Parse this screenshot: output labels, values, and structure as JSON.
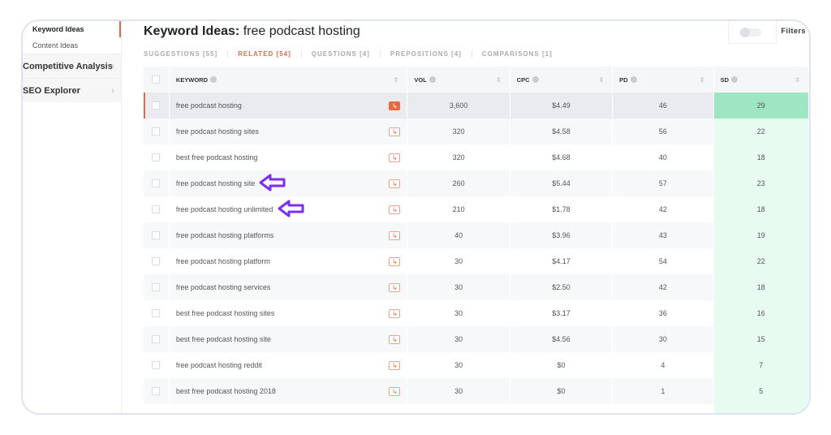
{
  "sidebar": {
    "sub_items": [
      "Keyword Ideas",
      "Content Ideas"
    ],
    "items": [
      "Competitive Analysis",
      "SEO Explorer"
    ]
  },
  "header": {
    "title_bold": "Keyword Ideas:",
    "title_query": "free podcast hosting",
    "filters_label": "Filters"
  },
  "tabs": [
    "SUGGESTIONS [55]",
    "RELATED [54]",
    "QUESTIONS [4]",
    "PREPOSITIONS [4]",
    "COMPARISONS [1]"
  ],
  "columns": [
    "KEYWORD",
    "VOL",
    "CPC",
    "PD",
    "SD"
  ],
  "rows": [
    {
      "keyword": "free podcast hosting",
      "vol": "3,600",
      "cpc": "$4.49",
      "pd": "46",
      "sd": "29"
    },
    {
      "keyword": "free podcast hosting sites",
      "vol": "320",
      "cpc": "$4.58",
      "pd": "56",
      "sd": "22"
    },
    {
      "keyword": "best free podcast hosting",
      "vol": "320",
      "cpc": "$4.68",
      "pd": "40",
      "sd": "18"
    },
    {
      "keyword": "free podcast hosting site",
      "vol": "260",
      "cpc": "$5.44",
      "pd": "57",
      "sd": "23"
    },
    {
      "keyword": "free podcast hosting unlimited",
      "vol": "210",
      "cpc": "$1.78",
      "pd": "42",
      "sd": "18"
    },
    {
      "keyword": "free podcast hosting platforms",
      "vol": "40",
      "cpc": "$3.96",
      "pd": "43",
      "sd": "19"
    },
    {
      "keyword": "free podcast hosting platform",
      "vol": "30",
      "cpc": "$4.17",
      "pd": "54",
      "sd": "22"
    },
    {
      "keyword": "free podcast hosting services",
      "vol": "30",
      "cpc": "$2.50",
      "pd": "42",
      "sd": "18"
    },
    {
      "keyword": "best free podcast hosting sites",
      "vol": "30",
      "cpc": "$3.17",
      "pd": "36",
      "sd": "16"
    },
    {
      "keyword": "best free podcast hosting site",
      "vol": "30",
      "cpc": "$4.56",
      "pd": "30",
      "sd": "15"
    },
    {
      "keyword": "free podcast hosting reddit",
      "vol": "30",
      "cpc": "$0",
      "pd": "4",
      "sd": "7"
    },
    {
      "keyword": "best free podcast hosting 2018",
      "vol": "30",
      "cpc": "$0",
      "pd": "1",
      "sd": "5"
    }
  ],
  "colors": {
    "accent": "#e06b4a",
    "sd_green": "#9ee6c3",
    "annotation_arrow": "#7b2ff2"
  }
}
